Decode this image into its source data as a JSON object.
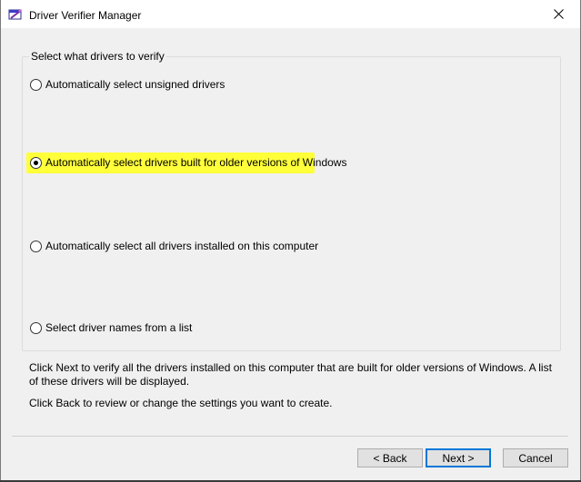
{
  "window": {
    "title": "Driver Verifier Manager",
    "icon": "driver-verifier-app-icon"
  },
  "group": {
    "label": "Select what drivers to verify",
    "options": [
      {
        "label": "Automatically select unsigned drivers",
        "checked": false
      },
      {
        "label": "Automatically select drivers built for older versions of Windows",
        "checked": true,
        "highlighted": true
      },
      {
        "label": "Automatically select all drivers installed on this computer",
        "checked": false
      },
      {
        "label": "Select driver names from a list",
        "checked": false
      }
    ]
  },
  "description": {
    "line1": "Click Next to verify all the drivers installed on this computer that are built for older versions of Windows. A list of these drivers will be displayed.",
    "line2": "Click Back to review or change the settings you want to create."
  },
  "buttons": {
    "back": "< Back",
    "next": "Next >",
    "cancel": "Cancel"
  },
  "colors": {
    "highlight": "#ffff3a",
    "default_button_border": "#0078d7",
    "dialog_background": "#f0f0f0"
  }
}
